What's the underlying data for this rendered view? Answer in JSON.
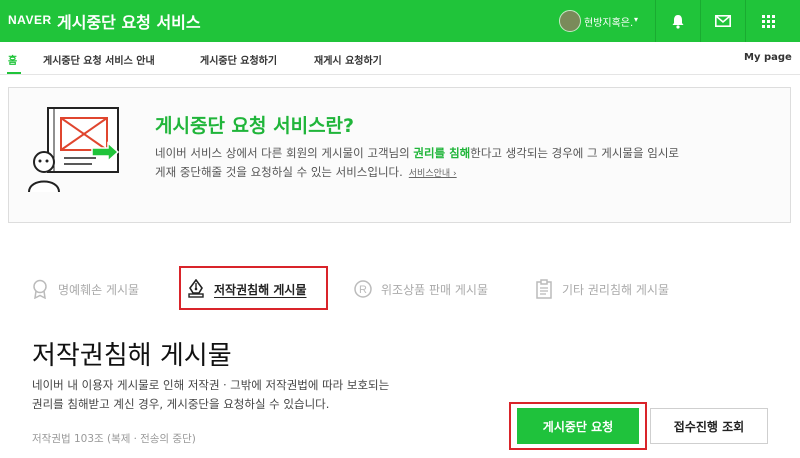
{
  "header": {
    "logo": "NAVER",
    "title": "게시중단 요청 서비스",
    "user_name": "현방지혹은.",
    "brand_color": "#20c43a"
  },
  "nav": {
    "items": [
      {
        "label": "홈",
        "active": true
      },
      {
        "label": "게시중단 요청 서비스 안내",
        "active": false
      },
      {
        "label": "게시중단 요청하기",
        "active": false
      },
      {
        "label": "재게시 요청하기",
        "active": false
      }
    ],
    "mypage": "My page"
  },
  "info": {
    "title": "게시중단 요청 서비스란?",
    "text_before": "네이버 서비스 상에서 다른 회원의 게시물이 고객님의 ",
    "highlight": "권리를 침해",
    "text_after": "한다고 생각되는 경우에 그 게시물을 임시로",
    "line2": "게재 중단해줄 것을 요청하실 수 있는 서비스입니다.",
    "more_link": "서비스안내 ›"
  },
  "categories": [
    {
      "label": "명예훼손 게시물",
      "icon": "ribbon-icon",
      "selected": false
    },
    {
      "label": "저작권침해 게시물",
      "icon": "pen-nib-icon",
      "selected": true
    },
    {
      "label": "위조상품 판매 게시물",
      "icon": "registered-icon",
      "selected": false
    },
    {
      "label": "기타 권리침해 게시물",
      "icon": "clipboard-icon",
      "selected": false
    }
  ],
  "section": {
    "title": "저작권침해 게시물",
    "desc_line1": "네이버 내 이용자 게시물로 인해 저작권ㆍ그밖에 저작권법에 따라 보호되는",
    "desc_line2": "권리를 침해받고 계신 경우, 게시중단을 요청하실 수 있습니다.",
    "law": "저작권법 103조 (복제ㆍ전송의 중단)"
  },
  "buttons": {
    "request": "게시중단 요청",
    "status": "접수진행 조회"
  }
}
